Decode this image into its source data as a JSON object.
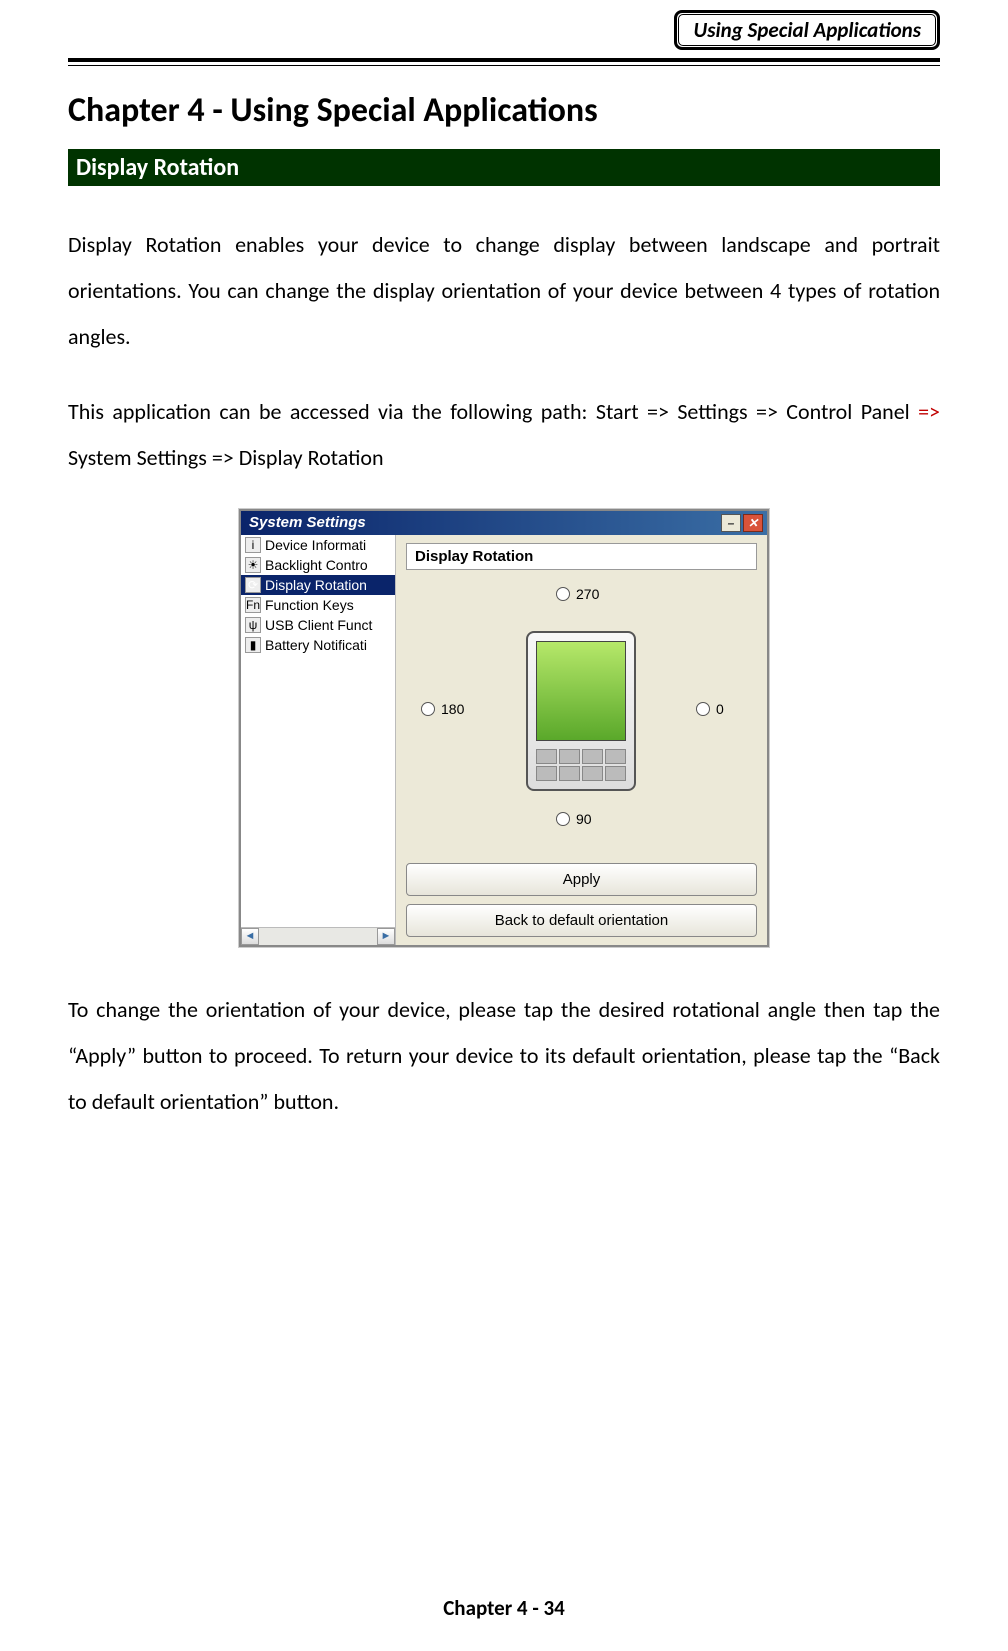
{
  "header": {
    "badge": "Using Special Applications"
  },
  "chapter": {
    "title": "Chapter 4  - Using Special Applications"
  },
  "section": {
    "title": "Display Rotation"
  },
  "para1": "Display Rotation enables your device to change display between landscape and portrait orientations. You can change the display orientation of your device between 4 types of rotation angles.",
  "para2a": "This application can be accessed via the following path: Start => Settings => Control Panel ",
  "para2b_red": "=>",
  "para2c": " System Settings => Display Rotation",
  "para3": "To change the orientation of your device, please tap the desired rotational angle then tap the “Apply” button to proceed. To return your device to its default orientation, please tap the “Back to default orientation” button.",
  "footer": "Chapter 4 - 34",
  "screenshot": {
    "title": "System Settings",
    "sideItems": [
      {
        "label": "Device Informati"
      },
      {
        "label": "Backlight Contro"
      },
      {
        "label": "Display Rotation",
        "selected": true
      },
      {
        "label": "Function Keys"
      },
      {
        "label": "USB Client Funct"
      },
      {
        "label": "Battery Notificati"
      }
    ],
    "paneTitle": "Display Rotation",
    "angles": {
      "top": "270",
      "right": "0",
      "bottom": "90",
      "left": "180"
    },
    "buttons": {
      "apply": "Apply",
      "back": "Back to default orientation"
    }
  }
}
